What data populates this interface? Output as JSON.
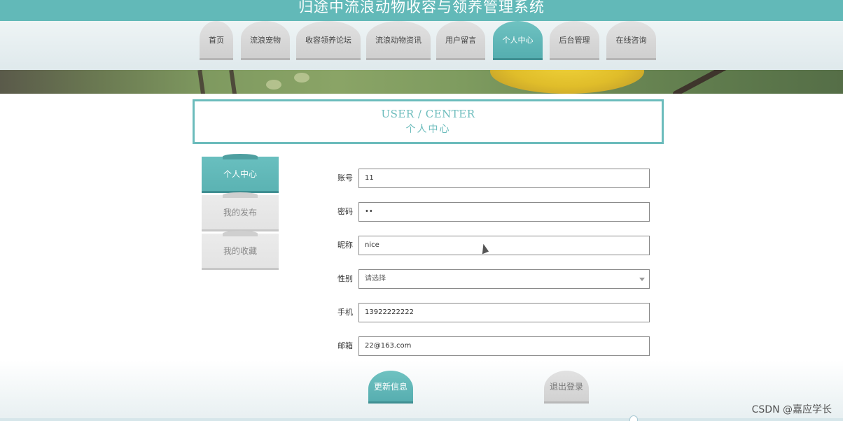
{
  "app": {
    "title": "归途中流浪动物收容与领养管理系统"
  },
  "nav": {
    "items": [
      {
        "label": "首页",
        "active": false
      },
      {
        "label": "流浪宠物",
        "active": false
      },
      {
        "label": "收容领养论坛",
        "active": false
      },
      {
        "label": "流浪动物资讯",
        "active": false
      },
      {
        "label": "用户留言",
        "active": false
      },
      {
        "label": "个人中心",
        "active": true
      },
      {
        "label": "后台管理",
        "active": false
      },
      {
        "label": "在线咨询",
        "active": false
      }
    ]
  },
  "page_header": {
    "en": "USER / CENTER",
    "zh": "个人中心"
  },
  "sidebar": {
    "items": [
      {
        "label": "个人中心",
        "active": true
      },
      {
        "label": "我的发布",
        "active": false
      },
      {
        "label": "我的收藏",
        "active": false
      }
    ]
  },
  "form": {
    "account": {
      "label": "账号",
      "value": "11"
    },
    "password": {
      "label": "密码",
      "value": "••"
    },
    "nickname": {
      "label": "昵称",
      "value": "nice"
    },
    "gender": {
      "label": "性别",
      "value": "请选择"
    },
    "phone": {
      "label": "手机",
      "value": "13922222222"
    },
    "email": {
      "label": "邮箱",
      "value": "22@163.com"
    }
  },
  "actions": {
    "update_label": "更新信息",
    "logout_label": "退出登录"
  },
  "watermark": "CSDN @嘉应学长",
  "colors": {
    "accent": "#62b9b8",
    "accent_dark": "#3f8f92",
    "inactive": "#d9d9d9"
  }
}
